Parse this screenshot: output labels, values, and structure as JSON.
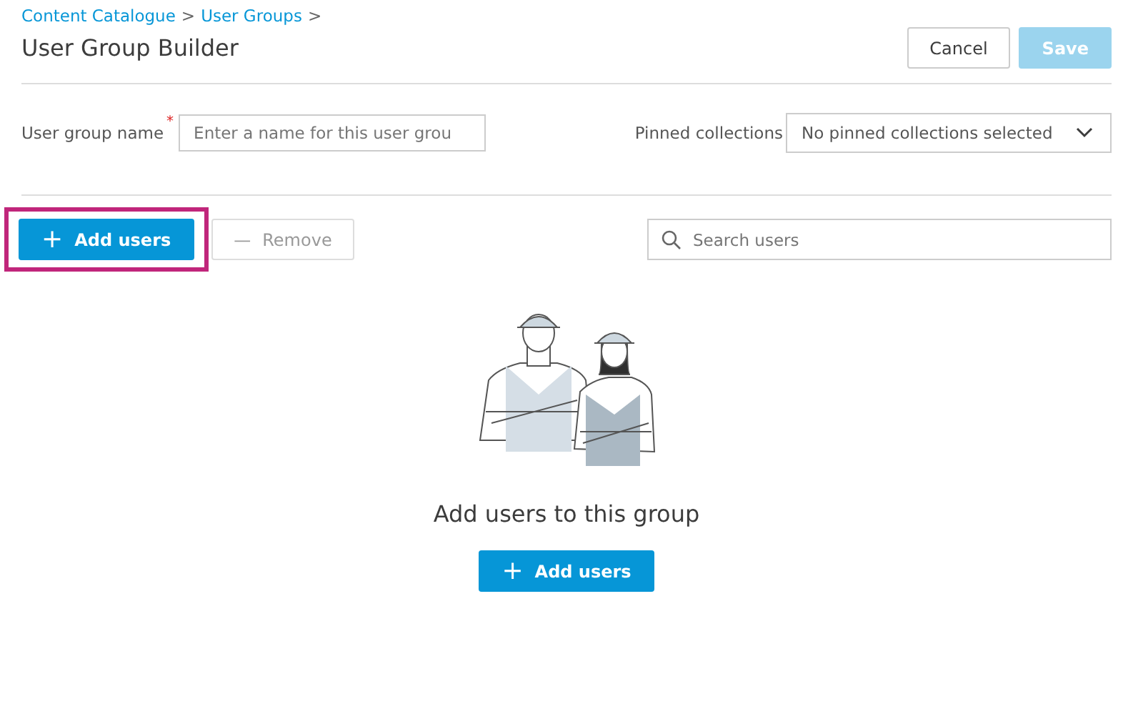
{
  "breadcrumb": [
    "Content Catalogue",
    "User Groups"
  ],
  "breadcrumb_separator": ">",
  "title": "User Group Builder",
  "header_buttons": [
    {
      "label": "Cancel",
      "kind": "secondary",
      "disabled": false
    },
    {
      "label": "Save",
      "kind": "primary",
      "disabled": true
    }
  ],
  "group_name": {
    "label": "User group name",
    "required_mark": "*",
    "placeholder": "Enter a name for this user grou"
  },
  "pinned_collections": {
    "label": "Pinned collections",
    "value": "No pinned collections selected"
  },
  "toolbar": {
    "add_button": {
      "label": "Add users",
      "icon": "+",
      "highlighted": true
    },
    "remove_button": {
      "label": "Remove",
      "icon": "—",
      "disabled": true
    },
    "search": {
      "placeholder": "Search users"
    }
  },
  "empty_state": {
    "message": "Add users to this group",
    "button": {
      "label": "Add users",
      "icon": "+"
    }
  }
}
